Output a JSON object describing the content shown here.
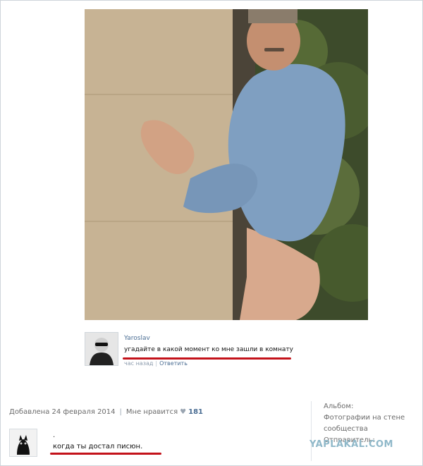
{
  "post_image": {
    "icon": "photo-wall-man-illustration"
  },
  "comment": {
    "author": "Yaroslav",
    "text": "угадайте в какой момент ко мне зашли в комнату",
    "time": "час назад",
    "reply_label": "Ответить",
    "avatar_icon": "user-avatar-sunglasses",
    "highlight_color": "#c3121a"
  },
  "footer": {
    "added": "Добавлена 24 февраля 2014",
    "like_label": "Мне нравится",
    "like_count": "181",
    "heart_icon": "heart-icon"
  },
  "sidebar": {
    "album_label": "Альбом:",
    "album_link": "Фотографии на стене сообщества",
    "sender_label": "Отправитель:"
  },
  "comment2": {
    "dot": ".",
    "text": "когда ты достал писюн.",
    "avatar_icon": "cat-avatar-icon"
  },
  "watermark": "YAPLAKAL.COM"
}
